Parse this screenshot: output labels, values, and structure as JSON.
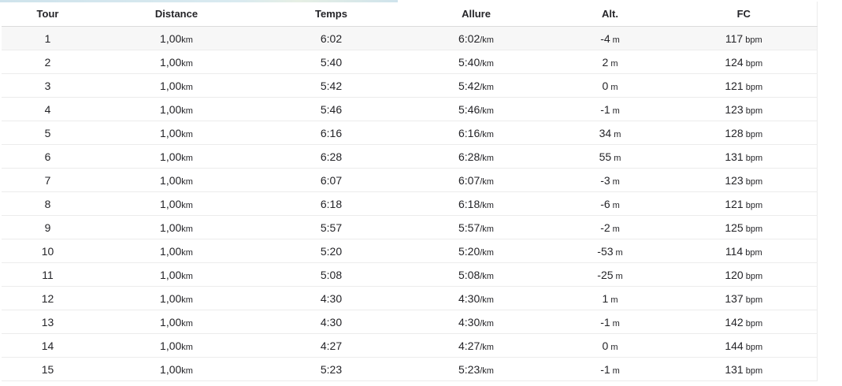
{
  "headers": {
    "lap": "Tour",
    "distance": "Distance",
    "time": "Temps",
    "pace": "Allure",
    "elevation": "Alt.",
    "heart_rate": "FC"
  },
  "units": {
    "distance": "km",
    "pace": "/km",
    "elevation": "m",
    "heart_rate": "bpm"
  },
  "rows": [
    {
      "lap": "1",
      "distance": "1,00",
      "time": "6:02",
      "pace": "6:02",
      "elevation": "-4",
      "heart_rate": "117"
    },
    {
      "lap": "2",
      "distance": "1,00",
      "time": "5:40",
      "pace": "5:40",
      "elevation": "2",
      "heart_rate": "124"
    },
    {
      "lap": "3",
      "distance": "1,00",
      "time": "5:42",
      "pace": "5:42",
      "elevation": "0",
      "heart_rate": "121"
    },
    {
      "lap": "4",
      "distance": "1,00",
      "time": "5:46",
      "pace": "5:46",
      "elevation": "-1",
      "heart_rate": "123"
    },
    {
      "lap": "5",
      "distance": "1,00",
      "time": "6:16",
      "pace": "6:16",
      "elevation": "34",
      "heart_rate": "128"
    },
    {
      "lap": "6",
      "distance": "1,00",
      "time": "6:28",
      "pace": "6:28",
      "elevation": "55",
      "heart_rate": "131"
    },
    {
      "lap": "7",
      "distance": "1,00",
      "time": "6:07",
      "pace": "6:07",
      "elevation": "-3",
      "heart_rate": "123"
    },
    {
      "lap": "8",
      "distance": "1,00",
      "time": "6:18",
      "pace": "6:18",
      "elevation": "-6",
      "heart_rate": "121"
    },
    {
      "lap": "9",
      "distance": "1,00",
      "time": "5:57",
      "pace": "5:57",
      "elevation": "-2",
      "heart_rate": "125"
    },
    {
      "lap": "10",
      "distance": "1,00",
      "time": "5:20",
      "pace": "5:20",
      "elevation": "-53",
      "heart_rate": "114"
    },
    {
      "lap": "11",
      "distance": "1,00",
      "time": "5:08",
      "pace": "5:08",
      "elevation": "-25",
      "heart_rate": "120"
    },
    {
      "lap": "12",
      "distance": "1,00",
      "time": "4:30",
      "pace": "4:30",
      "elevation": "1",
      "heart_rate": "137"
    },
    {
      "lap": "13",
      "distance": "1,00",
      "time": "4:30",
      "pace": "4:30",
      "elevation": "-1",
      "heart_rate": "142"
    },
    {
      "lap": "14",
      "distance": "1,00",
      "time": "4:27",
      "pace": "4:27",
      "elevation": "0",
      "heart_rate": "144"
    },
    {
      "lap": "15",
      "distance": "1,00",
      "time": "5:23",
      "pace": "5:23",
      "elevation": "-1",
      "heart_rate": "131"
    }
  ],
  "colors": {
    "text": "#242428",
    "row_highlight": "#f7f7f7",
    "divider": "#ececec"
  }
}
